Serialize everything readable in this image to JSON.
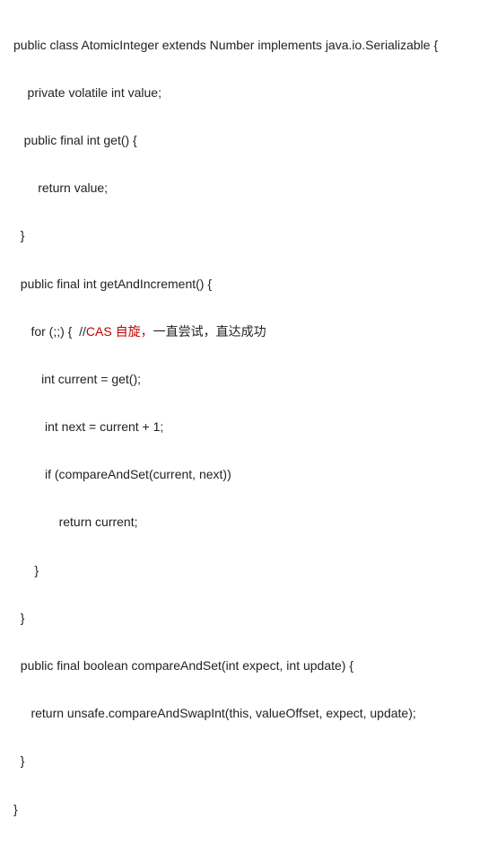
{
  "code": {
    "l1": "public class AtomicInteger extends Number implements java.io.Serializable {",
    "l2": "    private volatile int value;",
    "l3": "   public final int get() {",
    "l4": "       return value;",
    "l5": "  }",
    "l6": "  public final int getAndIncrement() {",
    "l7a": "     for (;;) {  //",
    "l7b": "CAS 自旋，",
    "l7c": "一直尝试，直达成功",
    "l8": "        int current = get();",
    "l9": "         int next = current + 1;",
    "l10": "         if (compareAndSet(current, next))",
    "l11": "             return current;",
    "l12": "      }",
    "l13": "  }",
    "l14": "  public final boolean compareAndSet(int expect, int update) {",
    "l15": "     return unsafe.compareAndSwapInt(this, valueOffset, expect, update);",
    "l16": "  }",
    "l17": "}"
  }
}
